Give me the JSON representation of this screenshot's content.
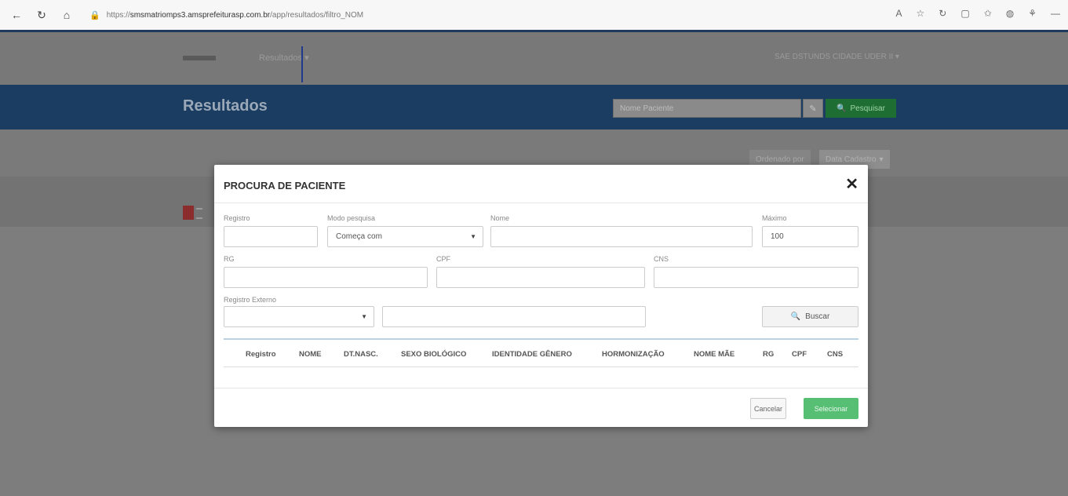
{
  "browser": {
    "url_prefix": "https://",
    "url_domain": "smsmatriomps3.amsprefeiturasp.com.br",
    "url_path": "/app/resultados/filtro_NOM"
  },
  "header": {
    "menu_results": "Resultados ▾",
    "user_menu": "SAE DSTUNDS CIDADE UDER II ▾"
  },
  "page": {
    "title": "Resultados",
    "search_placeholder": "Nome Paciente",
    "search_button": "Pesquisar",
    "sort_label": "Ordenado por",
    "sort_value": "Data Cadastro"
  },
  "modal": {
    "title": "PROCURA DE PACIENTE",
    "close": "✕",
    "labels": {
      "registro": "Registro",
      "modo_pesquisa": "Modo pesquisa",
      "nome": "Nome",
      "maximo": "Máximo",
      "rg": "RG",
      "cpf": "CPF",
      "cns": "CNS",
      "registro_externo": "Registro Externo"
    },
    "values": {
      "modo_pesquisa": "Começa com",
      "maximo": "100"
    },
    "buscar": "Buscar",
    "columns": [
      "Registro",
      "NOME",
      "DT.NASC.",
      "SEXO BIOLÓGICO",
      "IDENTIDADE GÊNERO",
      "HORMONIZAÇÃO",
      "NOME MÃE",
      "RG",
      "CPF",
      "CNS"
    ],
    "cancel": "Cancelar",
    "select": "Selecionar"
  }
}
